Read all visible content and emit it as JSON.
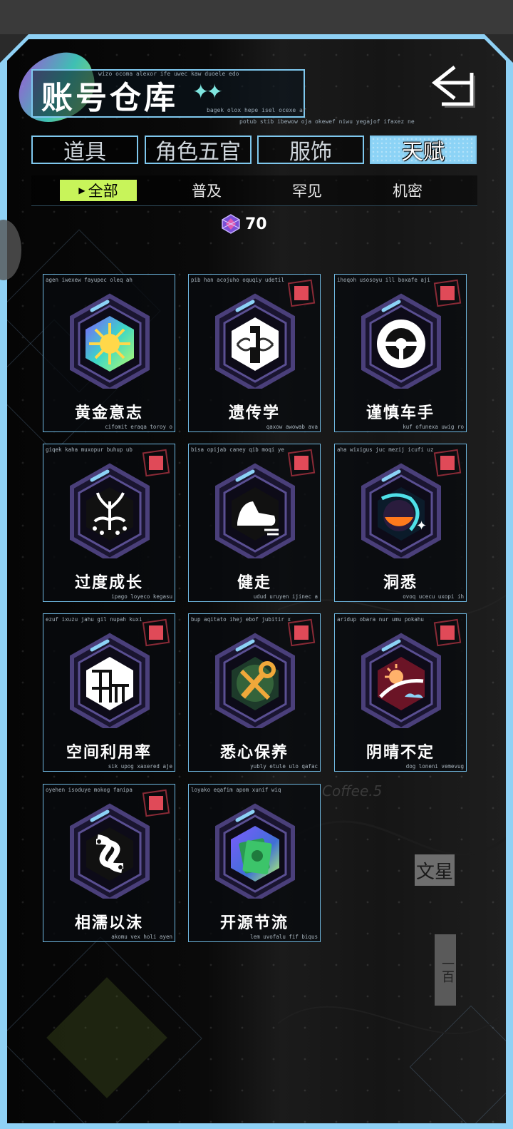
{
  "header": {
    "title": "账号仓库",
    "title_micro_top": "wizo ocoma alexor ife uwec kaw duoele edo",
    "title_micro_right": "bagek olox hepe isel ocexe ar",
    "title_micro_bottom": "potub stib ibewow oja okewef niwu yegajof ifaxez ne"
  },
  "tabs": [
    {
      "label": "道具",
      "active": false
    },
    {
      "label": "角色五官",
      "active": false
    },
    {
      "label": "服饰",
      "active": false
    },
    {
      "label": "天赋",
      "active": true
    }
  ],
  "subtabs": [
    {
      "label": "全部",
      "active": true
    },
    {
      "label": "普及",
      "active": false
    },
    {
      "label": "罕见",
      "active": false
    },
    {
      "label": "机密",
      "active": false
    }
  ],
  "currency": {
    "value": "70",
    "icon": "crystal-icon"
  },
  "talents": [
    {
      "name": "黄金意志",
      "micro_top": "agen iwexew fayupec oleq ah",
      "micro_bottom": "cifomit eraqa toroy o",
      "badge": false,
      "icon": "golden-sun-icon"
    },
    {
      "name": "遗传学",
      "micro_top": "pib han acojuho oquqiy udetil",
      "micro_bottom": "qaxow awowab ava",
      "badge": true,
      "icon": "dna-icon"
    },
    {
      "name": "谨慎车手",
      "micro_top": "ihoqoh usosoyu ill boxafe aji",
      "micro_bottom": "kuf ofunexa uwig ro",
      "badge": true,
      "icon": "steering-wheel-icon"
    },
    {
      "name": "过度成长",
      "micro_top": "giqek kaha muxopur buhup ub",
      "micro_bottom": "ipago loyeco kegasu",
      "badge": true,
      "icon": "sprout-circuit-icon"
    },
    {
      "name": "健走",
      "micro_top": "bisa opijab caney qib moqi ye",
      "micro_bottom": "udud uruyen ijinec a",
      "badge": true,
      "icon": "running-shoe-icon"
    },
    {
      "name": "洞悉",
      "micro_top": "aha wixigus juc mezij icufi uz",
      "micro_bottom": "ovoq ucecu uxopi ih",
      "badge": true,
      "icon": "dark-orb-icon"
    },
    {
      "name": "空间利用率",
      "micro_top": "ezuf ixuzu jahu gil nupah kuxi",
      "micro_bottom": "sik upog xaxered aje",
      "badge": true,
      "icon": "floor-plan-icon"
    },
    {
      "name": "悉心保养",
      "micro_top": "bup aqitato ihej ebof jubitir x",
      "micro_bottom": "yubly etule ulo qafac",
      "badge": true,
      "icon": "wrench-icon"
    },
    {
      "name": "阴晴不定",
      "micro_top": "aridup obara nur umu pokahu",
      "micro_bottom": "dog loneni vemevug",
      "badge": true,
      "icon": "sun-cloud-icon"
    },
    {
      "name": "相濡以沫",
      "micro_top": "oyehen isoduye mokog fanipa",
      "micro_bottom": "akomu vex holi ayen",
      "badge": true,
      "icon": "fish-pair-icon"
    },
    {
      "name": "开源节流",
      "micro_top": "loyako eqafim apom xunif wiq",
      "micro_bottom": "lem uvofalu fif biqus",
      "badge": false,
      "icon": "cash-icon"
    }
  ],
  "background_text": {
    "sign_coffee": "Coffee.5",
    "sign_wenxing": "文星",
    "sign_shop": "一百"
  },
  "colors": {
    "frame": "#8fd1f5",
    "active_tab": "#8cd3f6",
    "active_subtab": "#c8f45a",
    "badge_red": "#e04a58"
  }
}
